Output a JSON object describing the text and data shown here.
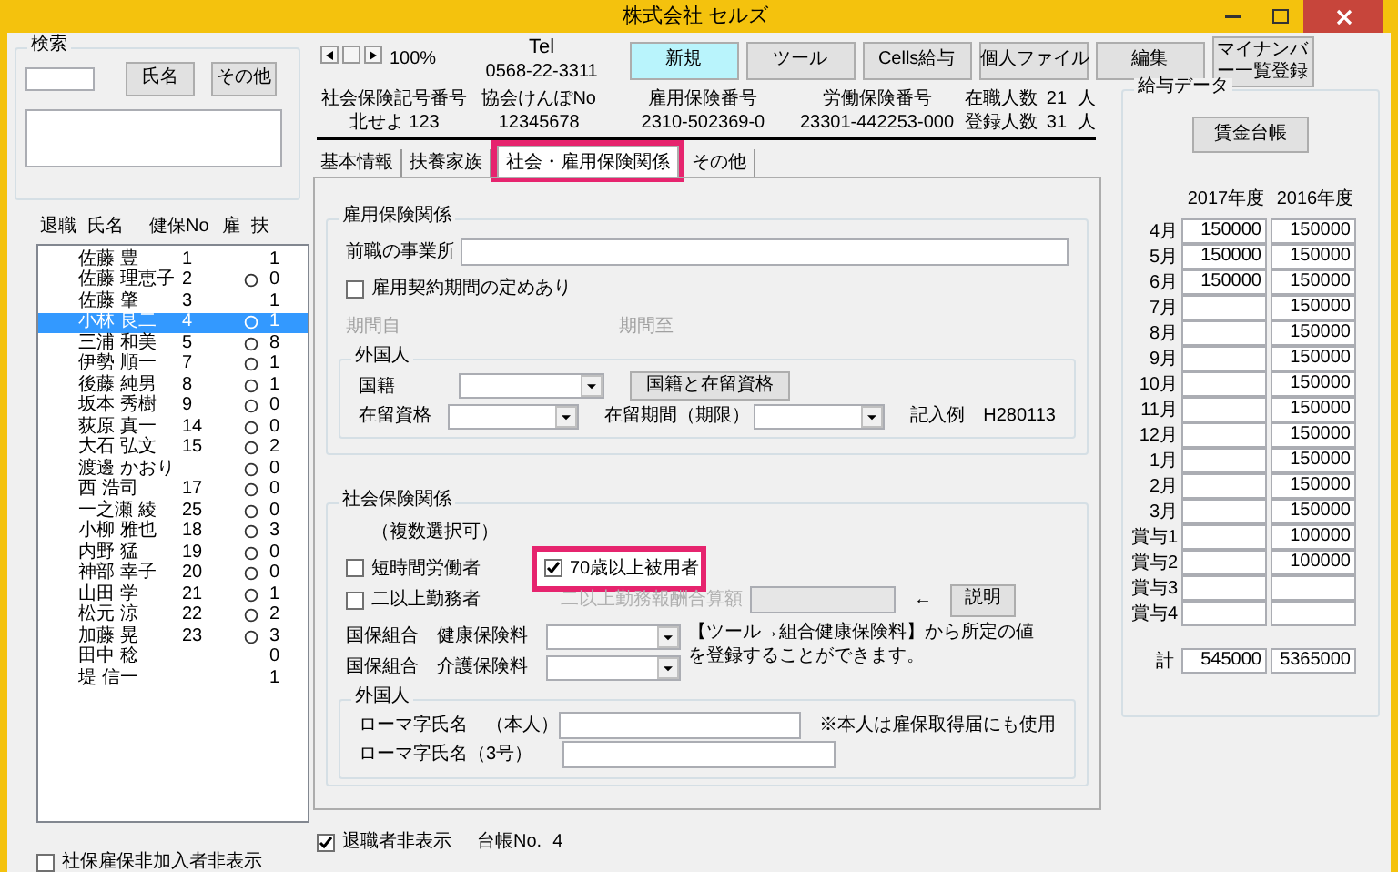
{
  "window": {
    "title": "株式会社 セルズ"
  },
  "search": {
    "title": "検索",
    "buttons": [
      "氏名",
      "その他"
    ]
  },
  "employee_list": {
    "columns": [
      "退職",
      "氏名",
      "健保No",
      "雇",
      "扶"
    ],
    "rows": [
      {
        "name": "佐藤 豊",
        "no": "1",
        "insured": false,
        "dependents": "1",
        "selected": false
      },
      {
        "name": "佐藤 理恵子",
        "no": "2",
        "insured": true,
        "dependents": "0",
        "selected": false
      },
      {
        "name": "佐藤 肇",
        "no": "3",
        "insured": false,
        "dependents": "1",
        "selected": false
      },
      {
        "name": "小林 良二",
        "no": "4",
        "insured": true,
        "dependents": "1",
        "selected": true
      },
      {
        "name": "三浦 和美",
        "no": "5",
        "insured": true,
        "dependents": "8",
        "selected": false
      },
      {
        "name": "伊勢 順一",
        "no": "7",
        "insured": true,
        "dependents": "1",
        "selected": false
      },
      {
        "name": "後藤 純男",
        "no": "8",
        "insured": true,
        "dependents": "1",
        "selected": false
      },
      {
        "name": "坂本 秀樹",
        "no": "9",
        "insured": true,
        "dependents": "0",
        "selected": false
      },
      {
        "name": "荻原 真一",
        "no": "14",
        "insured": true,
        "dependents": "0",
        "selected": false
      },
      {
        "name": "大石 弘文",
        "no": "15",
        "insured": true,
        "dependents": "2",
        "selected": false
      },
      {
        "name": "渡邊 かおり",
        "insured": true,
        "dependents": "0",
        "selected": false
      },
      {
        "name": "西 浩司",
        "no": "17",
        "insured": true,
        "dependents": "0",
        "selected": false
      },
      {
        "name": "一之瀬 綾",
        "no": "25",
        "insured": true,
        "dependents": "0",
        "selected": false
      },
      {
        "name": "小柳 雅也",
        "no": "18",
        "insured": true,
        "dependents": "3",
        "selected": false
      },
      {
        "name": "内野 猛",
        "no": "19",
        "insured": true,
        "dependents": "0",
        "selected": false
      },
      {
        "name": "神部 幸子",
        "no": "20",
        "insured": true,
        "dependents": "0",
        "selected": false
      },
      {
        "name": "山田 学",
        "no": "21",
        "insured": true,
        "dependents": "1",
        "selected": false
      },
      {
        "name": "松元 涼",
        "no": "22",
        "insured": true,
        "dependents": "2",
        "selected": false
      },
      {
        "name": "加藤 晃",
        "no": "23",
        "insured": true,
        "dependents": "3",
        "selected": false
      },
      {
        "name": "田中 稔",
        "insured": false,
        "dependents": "0",
        "selected": false
      },
      {
        "name": "堤 信一",
        "insured": false,
        "dependents": "1",
        "selected": false
      }
    ]
  },
  "hide_uninsured": {
    "label": "社保雇保非加入者非表示",
    "checked": false
  },
  "toolbar": {
    "zoom": "100%",
    "tel_label": "Tel",
    "tel": "0568-22-3311",
    "buttons": [
      {
        "label": "新規",
        "highlighted": true
      },
      {
        "label": "ツール",
        "highlighted": false
      },
      {
        "label": "Cells給与",
        "highlighted": false
      },
      {
        "label": "個人ファイル",
        "highlighted": false
      },
      {
        "label": "編集",
        "highlighted": false
      },
      {
        "label": "マイナンバー一覧登録",
        "highlighted": false
      }
    ]
  },
  "info": [
    {
      "label": "社会保険記号番号",
      "value": "北せよ 123"
    },
    {
      "label": "協会けんぽNo",
      "value": "12345678"
    },
    {
      "label": "雇用保険番号",
      "value": "2310-502369-0"
    },
    {
      "label": "労働保険番号",
      "value": "23301-442253-000"
    }
  ],
  "counts": [
    {
      "label": "在職人数",
      "value": "21",
      "unit": "人"
    },
    {
      "label": "登録人数",
      "value": "31",
      "unit": "人"
    }
  ],
  "tabs": [
    {
      "label": "基本情報",
      "selected": false,
      "marked": false
    },
    {
      "label": "扶養家族",
      "selected": false,
      "marked": false
    },
    {
      "label": "社会・雇用保険関係",
      "selected": true,
      "marked": true
    },
    {
      "label": "その他",
      "selected": false,
      "marked": false
    }
  ],
  "employment_insurance": {
    "title": "雇用保険関係",
    "previous_employer_label": "前職の事業所",
    "fixed_term": {
      "label": "雇用契約期間の定めあり",
      "checked": false
    },
    "period_from": "期間自",
    "period_to": "期間至",
    "period_disabled": true,
    "foreigner": {
      "title": "外国人",
      "nationality_label": "国籍",
      "button": "国籍と在留資格",
      "status_label": "在留資格",
      "period_label": "在留期間（期限）",
      "example": "記入例　H280113"
    }
  },
  "social_insurance": {
    "title": "社会保険関係",
    "note": "（複数選択可）",
    "options": [
      {
        "label": "短時間労働者",
        "checked": false,
        "marked": false
      },
      {
        "label": "70歳以上被用者",
        "checked": true,
        "marked": true
      },
      {
        "label": "二以上勤務者",
        "checked": false,
        "marked": false
      }
    ],
    "combined_label": "二以上勤務報酬合算額",
    "combined_disabled": true,
    "arrow": "←",
    "explain_button": "説明",
    "union_health_label": "国保組合　健康保険料",
    "union_care_label": "国保組合　介護保険料",
    "union_note": "【ツール→組合健康保険料】から所定の値を登録することができます。",
    "foreigner": {
      "title": "外国人",
      "romaji_self": "ローマ字氏名　（本人）",
      "romaji_dependent": "ローマ字氏名（3号）",
      "note": "※本人は雇保取得届にも使用"
    }
  },
  "hide_retired": {
    "label": "退職者非表示",
    "checked": true
  },
  "ledger": {
    "label": "台帳No.",
    "value": "4"
  },
  "salary": {
    "title": "給与データ",
    "button": "賃金台帳",
    "years": [
      "2017年度",
      "2016年度"
    ],
    "rows": [
      {
        "label": "4月",
        "current": "150000",
        "previous": "150000"
      },
      {
        "label": "5月",
        "current": "150000",
        "previous": "150000"
      },
      {
        "label": "6月",
        "current": "150000",
        "previous": "150000"
      },
      {
        "label": "7月",
        "previous": "150000"
      },
      {
        "label": "8月",
        "previous": "150000"
      },
      {
        "label": "9月",
        "previous": "150000"
      },
      {
        "label": "10月",
        "previous": "150000"
      },
      {
        "label": "11月",
        "previous": "150000"
      },
      {
        "label": "12月",
        "previous": "150000"
      },
      {
        "label": "1月",
        "previous": "150000"
      },
      {
        "label": "2月",
        "previous": "150000"
      },
      {
        "label": "3月",
        "previous": "150000"
      },
      {
        "label": "賞与1",
        "previous": "100000"
      },
      {
        "label": "賞与2",
        "previous": "100000"
      },
      {
        "label": "賞与3"
      },
      {
        "label": "賞与4"
      }
    ],
    "total": {
      "label": "計",
      "current": "545000",
      "previous": "5365000"
    }
  }
}
